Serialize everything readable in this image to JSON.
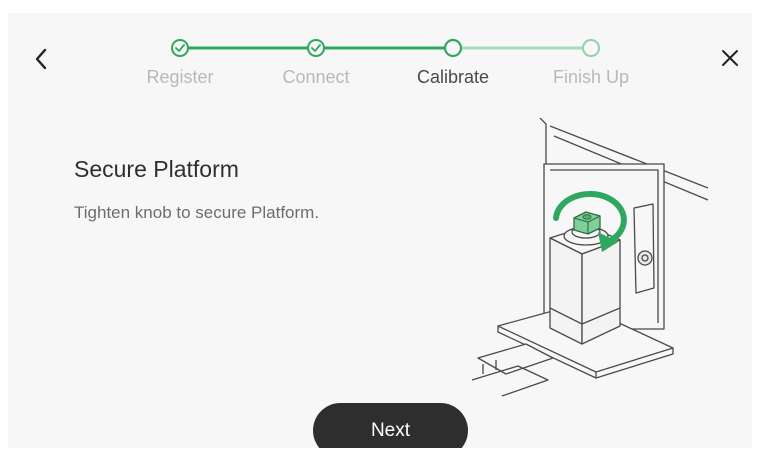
{
  "wizard": {
    "steps": [
      {
        "label": "Register",
        "state": "done"
      },
      {
        "label": "Connect",
        "state": "done"
      },
      {
        "label": "Calibrate",
        "state": "current"
      },
      {
        "label": "Finish Up",
        "state": "pending"
      }
    ]
  },
  "nav": {
    "back_icon": "chevron-left-icon",
    "close_icon": "close-icon"
  },
  "content": {
    "title": "Secure Platform",
    "instruction": "Tighten knob to secure Platform."
  },
  "footer": {
    "next_label": "Next"
  },
  "colors": {
    "accent": "#2fa85f",
    "dark": "#2e2e2e",
    "background": "#f7f7f7"
  }
}
